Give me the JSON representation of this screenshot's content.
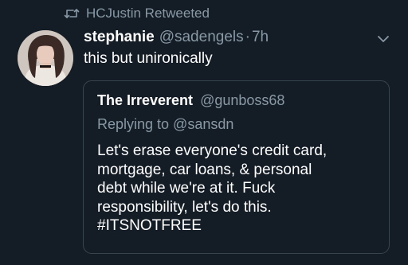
{
  "retweet": {
    "icon": "retweet-icon",
    "label": "HCJustin Retweeted"
  },
  "tweet": {
    "avatar": "avatar",
    "display_name": "stephanie",
    "handle": "@sadengels",
    "separator": "·",
    "time": "7h",
    "text": "this but unironically",
    "menu_icon": "chevron-down-icon"
  },
  "quoted_tweet": {
    "display_name": "The Irreverent",
    "handle": "@gunboss68",
    "replying_to": "Replying to @sansdn",
    "lines": [
      "Let's erase everyone's credit card,",
      "mortgage, car loans, & personal",
      "debt while we're at it. Fuck",
      "responsibility, let's do this.",
      "#ITSNOTFREE"
    ]
  },
  "colors": {
    "background": "#141d26",
    "secondary_text": "#8899a6",
    "primary_text": "#ffffff",
    "card_border": "#38444d"
  }
}
